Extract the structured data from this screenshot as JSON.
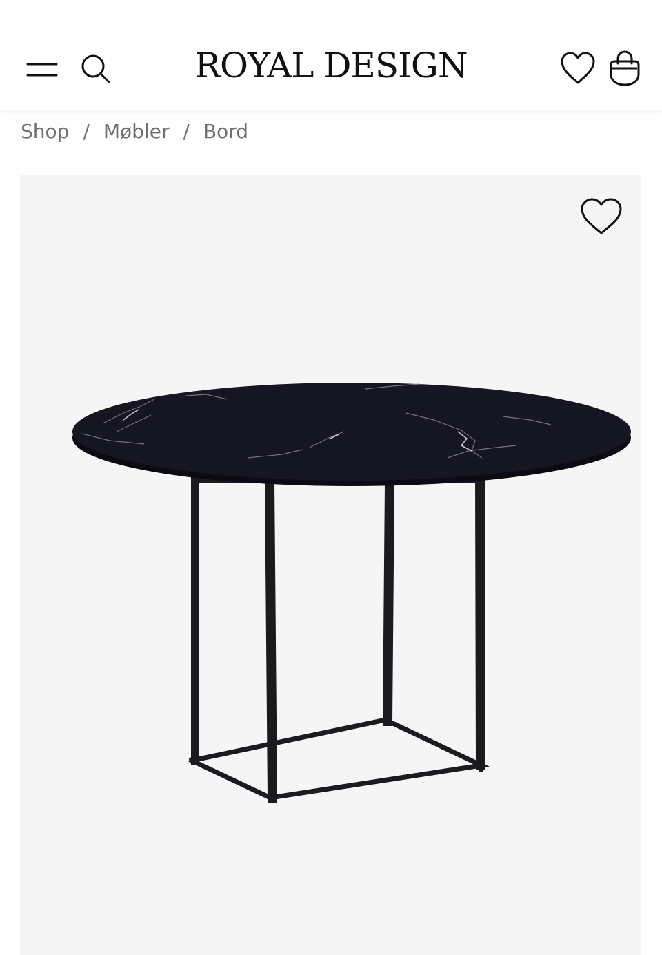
{
  "header": {
    "logo": "ROYAL DESIGN",
    "icons": {
      "menu": "hamburger-menu-icon",
      "search": "search-icon",
      "wishlist": "heart-icon",
      "cart": "shopping-bag-icon"
    }
  },
  "breadcrumb": {
    "items": [
      "Shop",
      "Møbler",
      "Bord"
    ],
    "separator": "/"
  },
  "product": {
    "image_icon": "round-marble-dining-table-image",
    "favorite_icon": "heart-icon"
  },
  "colors": {
    "panel_background": "#f5f5f6",
    "marble": "#141320",
    "frame": "#1b1b1f",
    "breadcrumb_text": "#6f6f6f"
  }
}
